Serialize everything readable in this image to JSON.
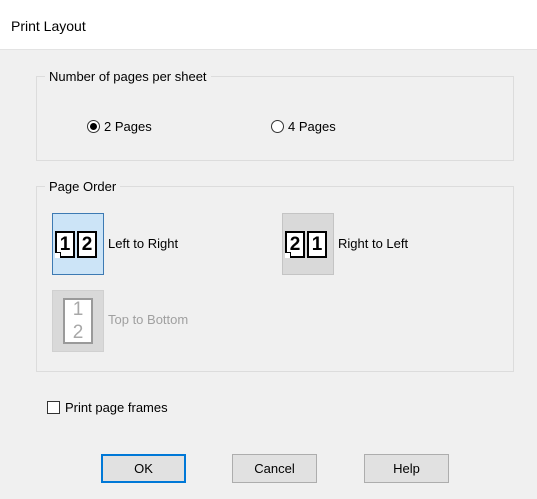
{
  "dialog": {
    "title": "Print Layout"
  },
  "pages_per_sheet": {
    "legend": "Number of pages per sheet",
    "options": [
      {
        "label": "2 Pages",
        "selected": true
      },
      {
        "label": "4 Pages",
        "selected": false
      }
    ]
  },
  "page_order": {
    "legend": "Page Order",
    "options": [
      {
        "label": "Left to Right",
        "pages": [
          "1",
          "2"
        ],
        "selected": true,
        "enabled": true
      },
      {
        "label": "Right to Left",
        "pages": [
          "2",
          "1"
        ],
        "selected": false,
        "enabled": true
      },
      {
        "label": "Top to Bottom",
        "pages": [
          "1",
          "2"
        ],
        "selected": false,
        "enabled": false
      }
    ]
  },
  "print_frames": {
    "label": "Print page frames",
    "checked": false
  },
  "buttons": {
    "ok": "OK",
    "cancel": "Cancel",
    "help": "Help"
  },
  "colors": {
    "selected_tile": "#cce4f7",
    "default_button_border": "#0078d7",
    "dialog_background": "#f0f0f0"
  }
}
